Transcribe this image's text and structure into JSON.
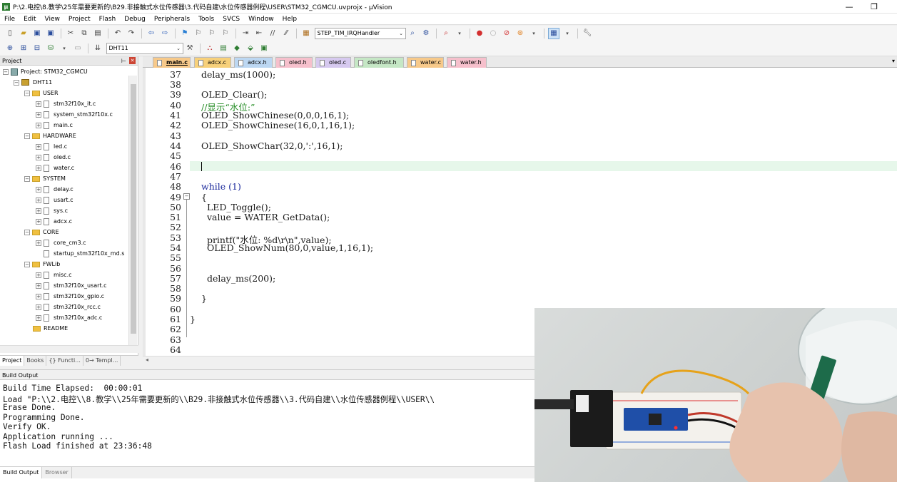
{
  "window": {
    "title": "P:\\2.电控\\8.教学\\25年需要更新的\\B29.非接触式水位传感器\\3.代码自建\\水位传感器例程\\USER\\STM32_CGMCU.uvprojx - µVision",
    "app_icon": "µ",
    "minimize": "—",
    "restore": "❐"
  },
  "menu": [
    "File",
    "Edit",
    "View",
    "Project",
    "Flash",
    "Debug",
    "Peripherals",
    "Tools",
    "SVCS",
    "Window",
    "Help"
  ],
  "toolbar": {
    "function_combo": "STEP_TIM_IRQHandler",
    "target_combo": "DHT11"
  },
  "project_panel": {
    "header": "Project",
    "root": "Project: STM32_CGMCU",
    "target": "DHT11",
    "groups": [
      {
        "name": "USER",
        "files": [
          "stm32f10x_it.c",
          "system_stm32f10x.c",
          "main.c"
        ]
      },
      {
        "name": "HARDWARE",
        "files": [
          "led.c",
          "oled.c",
          "water.c"
        ]
      },
      {
        "name": "SYSTEM",
        "files": [
          "delay.c",
          "usart.c",
          "sys.c",
          "adcx.c"
        ]
      },
      {
        "name": "CORE",
        "files": [
          "core_cm3.c",
          "startup_stm32f10x_md.s"
        ]
      },
      {
        "name": "FWLib",
        "files": [
          "misc.c",
          "stm32f10x_usart.c",
          "stm32f10x_gpio.c",
          "stm32f10x_rcc.c",
          "stm32f10x_adc.c"
        ]
      },
      {
        "name": "README",
        "files": []
      }
    ],
    "tabs": [
      "Project",
      "Books",
      "{} Functi...",
      "0→ Templ..."
    ]
  },
  "editor": {
    "tabs": [
      {
        "label": "main.c",
        "color": "#f7c98a",
        "active": true
      },
      {
        "label": "adcx.c",
        "color": "#f7d07a"
      },
      {
        "label": "adcx.h",
        "color": "#bcd7f2"
      },
      {
        "label": "oled.h",
        "color": "#f6c0cc"
      },
      {
        "label": "oled.c",
        "color": "#d6c9ef"
      },
      {
        "label": "oledfont.h",
        "color": "#c5e7c5"
      },
      {
        "label": "water.c",
        "color": "#f7c98a"
      },
      {
        "label": "water.h",
        "color": "#f6c0cc"
      }
    ],
    "lines": [
      {
        "n": "37",
        "code": "delay_ms(1000);"
      },
      {
        "n": "38",
        "code": ""
      },
      {
        "n": "39",
        "code": "OLED_Clear();"
      },
      {
        "n": "40",
        "code": "//显示“水位:”",
        "style": "cm"
      },
      {
        "n": "41",
        "code": "OLED_ShowChinese(0,0,0,16,1);"
      },
      {
        "n": "42",
        "code": "OLED_ShowChinese(16,0,1,16,1);"
      },
      {
        "n": "43",
        "code": ""
      },
      {
        "n": "44",
        "code": "OLED_ShowChar(32,0,':',16,1);"
      },
      {
        "n": "45",
        "code": ""
      },
      {
        "n": "46",
        "code": "",
        "current": true
      },
      {
        "n": "47",
        "code": ""
      },
      {
        "n": "48",
        "code": "while (1)",
        "style": "kw"
      },
      {
        "n": "49",
        "code": "{",
        "fold": true
      },
      {
        "n": "50",
        "code": "  LED_Toggle();"
      },
      {
        "n": "51",
        "code": "  value = WATER_GetData();"
      },
      {
        "n": "52",
        "code": ""
      },
      {
        "n": "53",
        "code": "  printf(\"水位: %d\\r\\n\",value);"
      },
      {
        "n": "54",
        "code": "  OLED_ShowNum(80,0,value,1,16,1);"
      },
      {
        "n": "55",
        "code": ""
      },
      {
        "n": "56",
        "code": ""
      },
      {
        "n": "57",
        "code": "  delay_ms(200);"
      },
      {
        "n": "58",
        "code": ""
      },
      {
        "n": "59",
        "code": "}"
      },
      {
        "n": "60",
        "code": ""
      },
      {
        "n": "61",
        "code": "}"
      },
      {
        "n": "62",
        "code": ""
      },
      {
        "n": "63",
        "code": ""
      },
      {
        "n": "64",
        "code": ""
      }
    ]
  },
  "build_output": {
    "header": "Build Output",
    "lines": [
      "Build Time Elapsed:  00:00:01",
      "Load \"P:\\\\2.电控\\\\8.教学\\\\25年需要更新的\\\\B29.非接触式水位传感器\\\\3.代码自建\\\\水位传感器例程\\\\USER\\\\",
      "Erase Done.",
      "Programming Done.",
      "Verify OK.",
      "Application running ...",
      "Flash Load finished at 23:36:48"
    ],
    "tabs": [
      "Build Output",
      "Browser"
    ]
  }
}
